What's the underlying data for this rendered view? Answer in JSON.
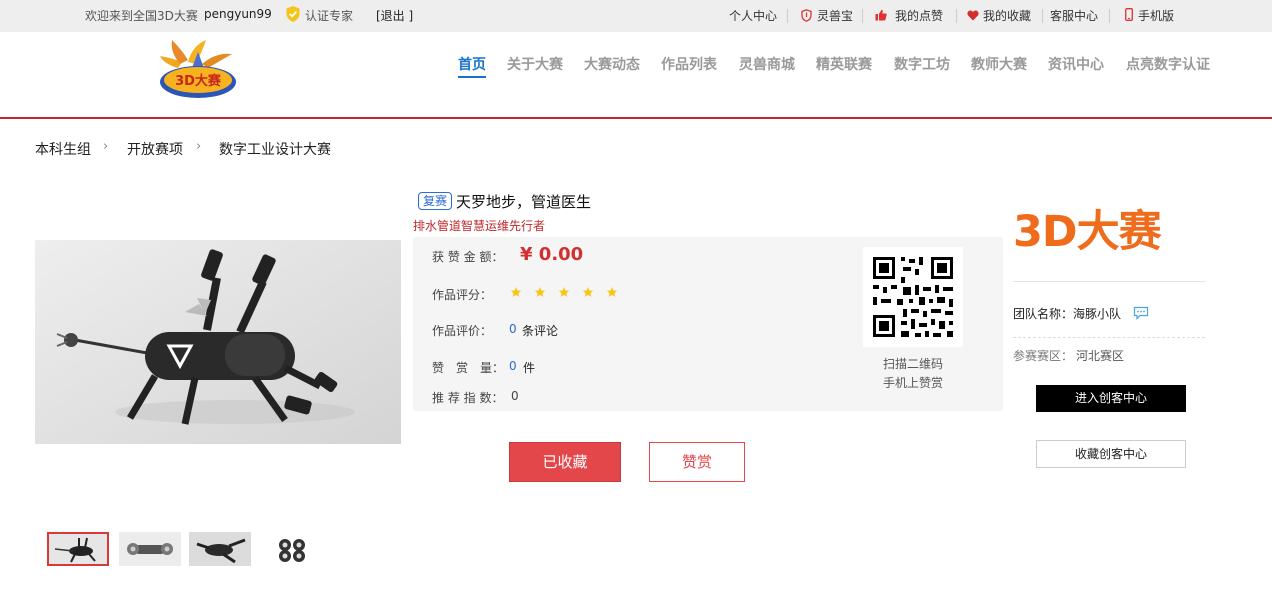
{
  "topbar": {
    "welcome": "欢迎来到全国3D大赛",
    "username": "pengyun99",
    "cert": "认证专家",
    "logout": "[退出 ]",
    "links": {
      "personal": "个人中心",
      "lingshoubao": "灵兽宝",
      "my_likes": "我的点赞",
      "my_favorites": "我的收藏",
      "service": "客服中心",
      "mobile": "手机版"
    }
  },
  "nav": [
    "首页",
    "关于大赛",
    "大赛动态",
    "作品列表",
    "灵兽商城",
    "精英联赛",
    "数字工坊",
    "教师大赛",
    "资讯中心",
    "点亮数字认证"
  ],
  "breadcrumb": [
    "本科生组",
    "开放赛项",
    "数字工业设计大赛"
  ],
  "work": {
    "tag": "复赛",
    "title": "天罗地步，管道医生",
    "subtitle": "排水管道智慧运维先行者",
    "reward_label": "获 赞 金 额：",
    "reward_value": "¥ 0.00",
    "score_label": "作品评分：",
    "score_stars": 5,
    "review_label": "作品评价：",
    "review_count": "0",
    "review_unit": "条评论",
    "likes_label": "赞　赏　量：",
    "likes_count": "0",
    "likes_unit": "件",
    "recommend_label": "推 荐 指 数：",
    "recommend_value": "0",
    "qr_text_1": "扫描二维码",
    "qr_text_2": "手机上赞赏",
    "fav_button": "已收藏",
    "reward_button": "赞赏"
  },
  "side": {
    "logo_text": "3D大赛",
    "team_label": "团队名称：",
    "team_name": "海豚小队",
    "region_label": "参赛赛区：",
    "region_name": "河北赛区",
    "enter_button": "进入创客中心",
    "collect_button": "收藏创客中心"
  },
  "colors": {
    "accent": "#c0282b",
    "nav_active": "#1a73c9",
    "price": "#d32f2f",
    "star": "#f6c71b"
  }
}
